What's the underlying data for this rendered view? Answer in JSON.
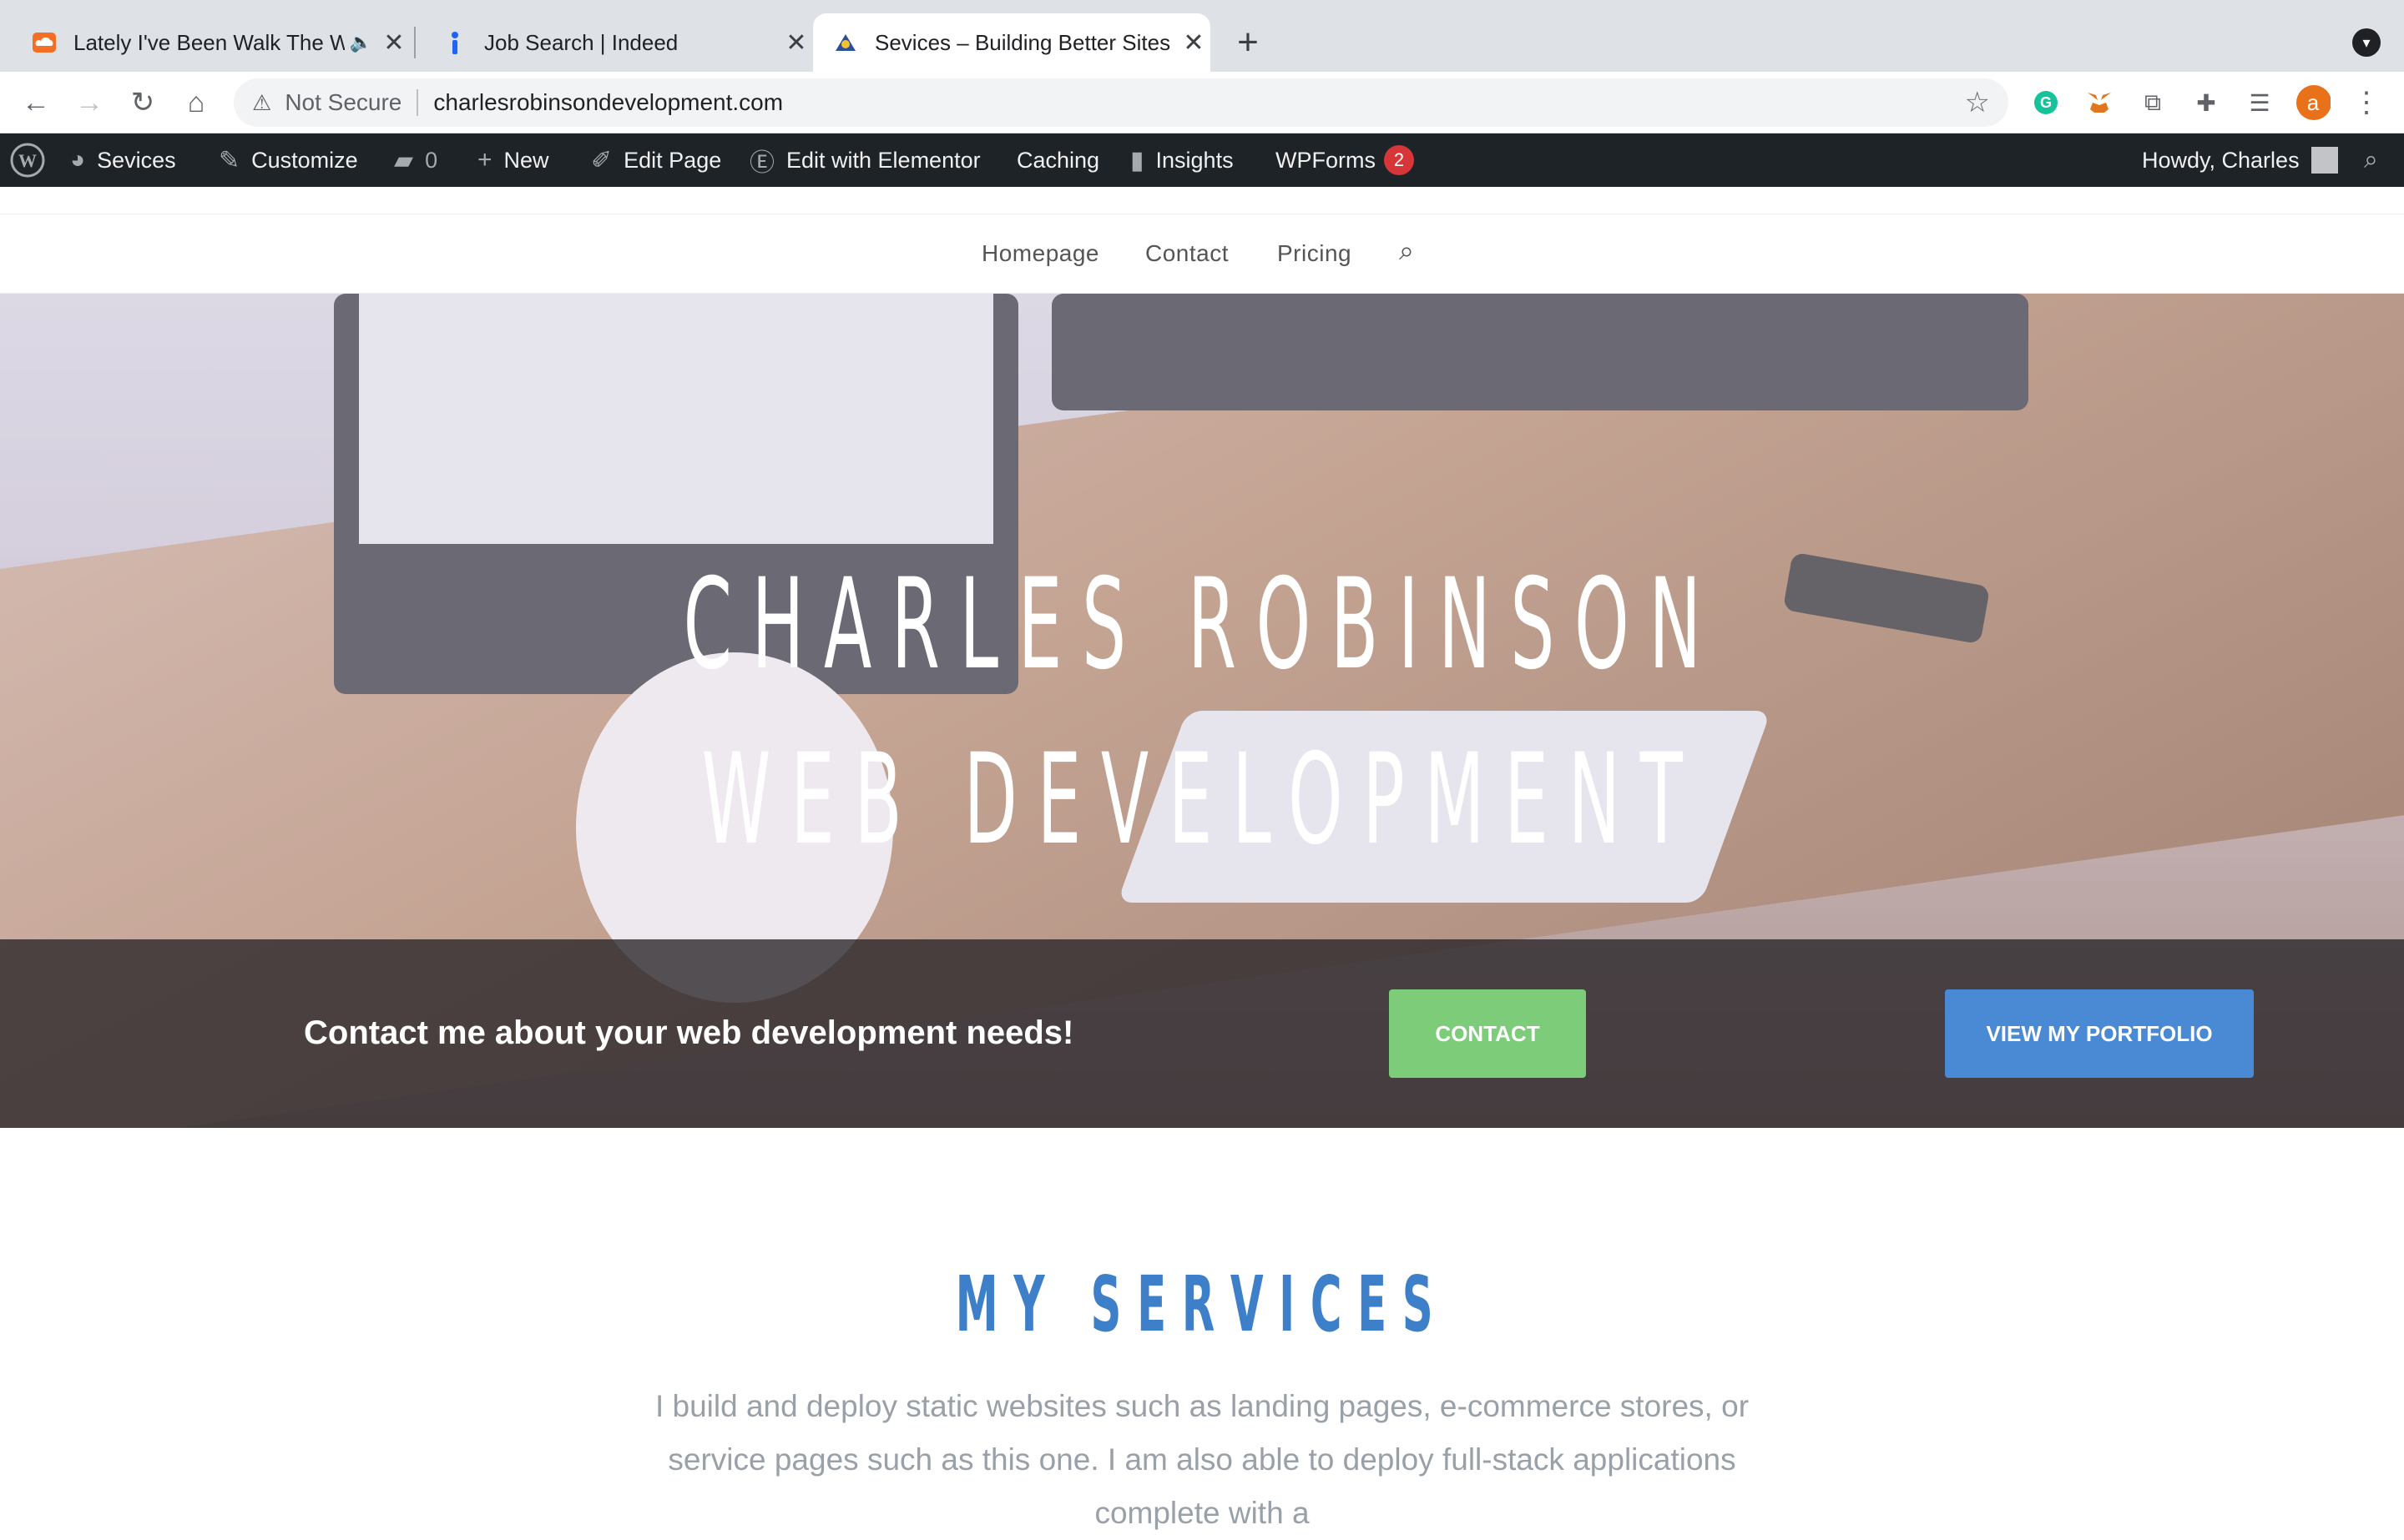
{
  "browser": {
    "tabs": [
      {
        "title": "Lately I've Been Walk The W",
        "favicon": "soundcloud-icon",
        "audio": true
      },
      {
        "title": "Job Search | Indeed",
        "favicon": "indeed-icon"
      },
      {
        "title": "Sevices – Building Better Sites",
        "favicon": "site-icon",
        "active": true
      }
    ],
    "address": {
      "security": "Not Secure",
      "url": "charlesrobinsondevelopment.com"
    },
    "profile_initial": "a"
  },
  "wp_admin_bar": {
    "site": "Sevices",
    "customize": "Customize",
    "comments": "0",
    "new": "New",
    "edit_page": "Edit Page",
    "elementor": "Edit with Elementor",
    "caching": "Caching",
    "insights": "Insights",
    "wpforms": "WPForms",
    "wpforms_count": "2",
    "howdy": "Howdy, Charles"
  },
  "site_nav": {
    "items": [
      "Homepage",
      "Contact",
      "Pricing"
    ]
  },
  "hero": {
    "line1": "CHARLES ROBINSON",
    "line2": "WEB DEVELOPMENT",
    "cta_text": "Contact me about your web development needs!",
    "contact_label": "CONTACT",
    "portfolio_label": "VIEW MY PORTFOLIO"
  },
  "services": {
    "title": "MY SERVICES",
    "body": "I build and deploy static websites such as landing pages, e-commerce stores, or service pages such as this one. I am also able to deploy full-stack applications complete with a"
  },
  "colors": {
    "contact_button": "#7ccc7a",
    "portfolio_button": "#4a8ad4",
    "services_title": "#3d7fc9",
    "wp_bar": "#1d2327"
  }
}
